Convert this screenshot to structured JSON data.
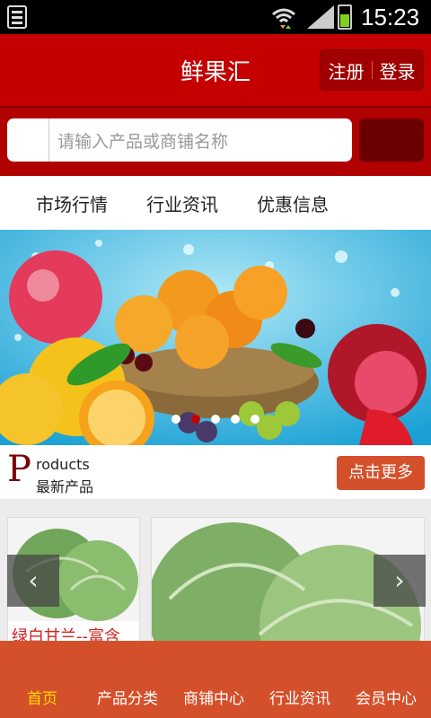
{
  "status_bar": {
    "time": "15:23"
  },
  "header": {
    "title": "鲜果汇",
    "register": "注册",
    "login": "登录"
  },
  "search": {
    "placeholder": "请输入产品或商铺名称"
  },
  "quick_nav": [
    "市场行情",
    "行业资讯",
    "优惠信息"
  ],
  "banner": {
    "slide_count": 5,
    "active_index": 1
  },
  "products_section": {
    "letter": "P",
    "title_en": "roducts",
    "title_cn": "最新产品",
    "more": "点击更多"
  },
  "products": [
    {
      "name": "绿白甘兰--富含"
    }
  ],
  "bottom_nav": {
    "tabs": [
      "首页",
      "产品分类",
      "商铺中心",
      "行业资讯",
      "会员中心"
    ],
    "active": 0
  },
  "colors": {
    "header_red": "#c40000",
    "search_bg": "#b00000",
    "accent_orange": "#d4502b",
    "active_tab": "#ffdd00"
  }
}
